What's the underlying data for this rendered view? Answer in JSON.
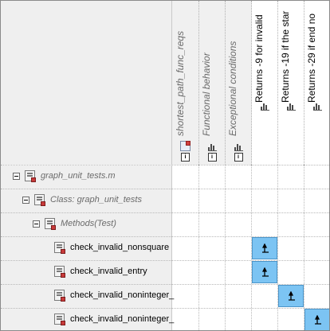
{
  "columns": [
    {
      "label": "shortest_path_func_reqs",
      "kind": "requirement-set"
    },
    {
      "label": "Functional behavior",
      "kind": "category"
    },
    {
      "label": "Exceptional conditions",
      "kind": "category"
    },
    {
      "label": "Returns -9 for invalid",
      "kind": "requirement"
    },
    {
      "label": "Returns -19 if the star",
      "kind": "requirement"
    },
    {
      "label": "Returns -29 if end no",
      "kind": "requirement"
    }
  ],
  "rows": [
    {
      "label": "graph_unit_tests.m",
      "style": "gray",
      "expanded": true
    },
    {
      "label": "Class: graph_unit_tests",
      "style": "gray",
      "expanded": true
    },
    {
      "label": "Methods(Test)",
      "style": "gray",
      "expanded": true
    },
    {
      "label": "check_invalid_nonsquare",
      "style": "black"
    },
    {
      "label": "check_invalid_entry",
      "style": "black"
    },
    {
      "label": "check_invalid_noninteger_",
      "style": "black"
    },
    {
      "label": "check_invalid_noninteger_",
      "style": "black"
    }
  ],
  "links": [
    {
      "row": 3,
      "col": 3
    },
    {
      "row": 4,
      "col": 3
    },
    {
      "row": 5,
      "col": 4
    },
    {
      "row": 6,
      "col": 5
    }
  ],
  "colors": {
    "link_cell": "#7cc4f3",
    "header_gray": "#efefef"
  }
}
